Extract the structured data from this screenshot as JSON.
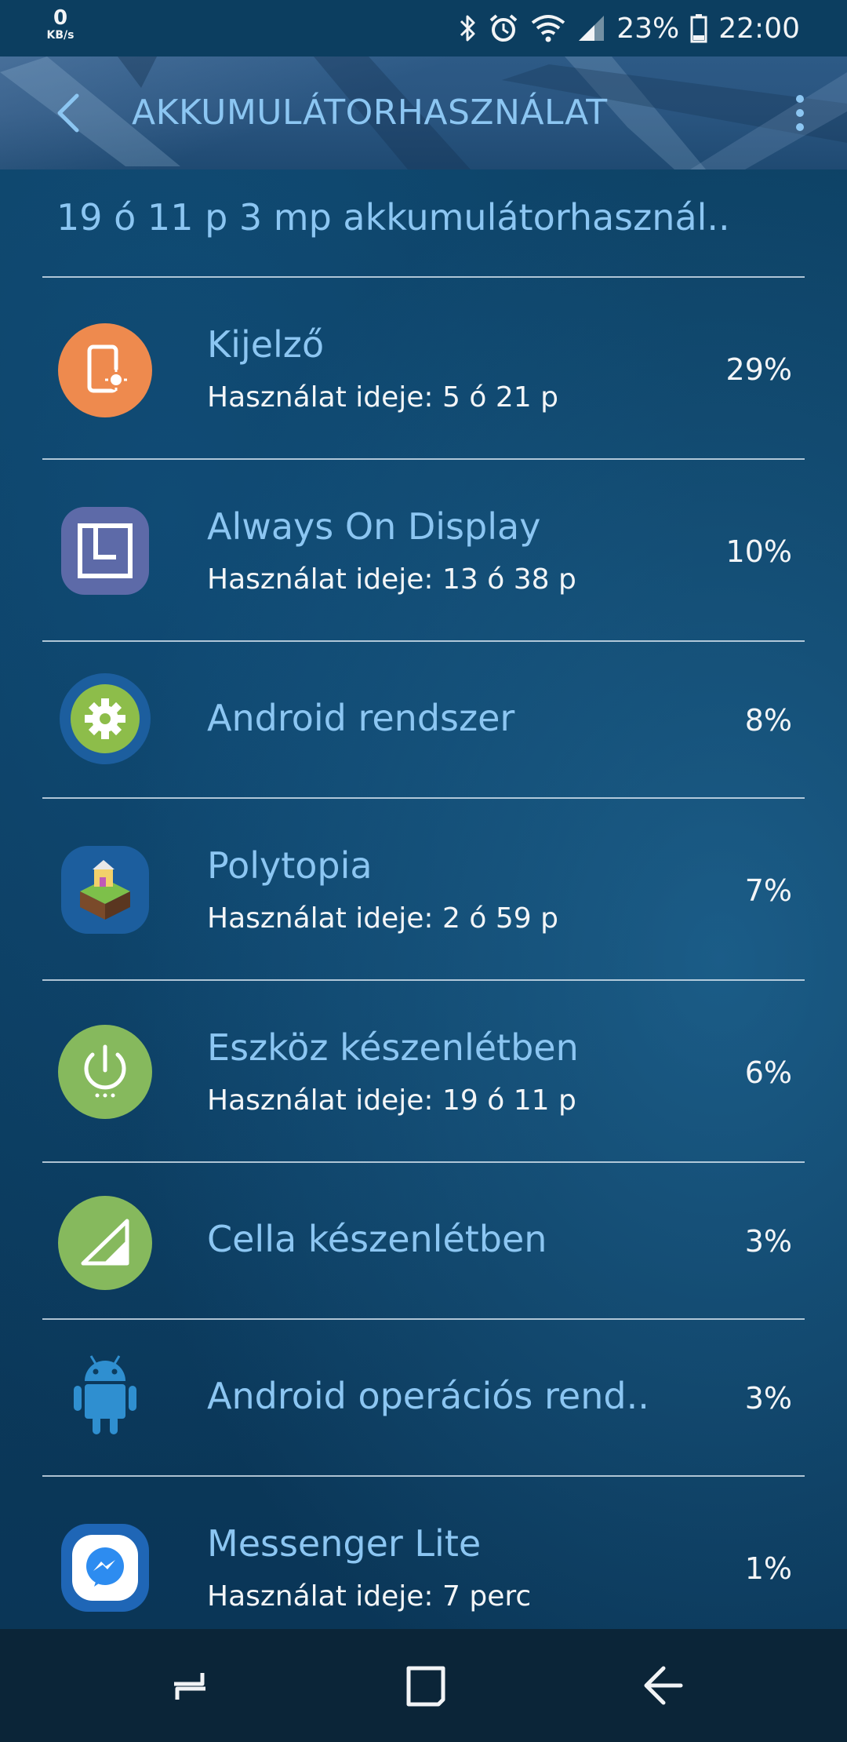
{
  "status_bar": {
    "net_speed_value": "0",
    "net_speed_unit": "KB/s",
    "battery_level": "23%",
    "time": "22:00",
    "icons": [
      "bluetooth-icon",
      "alarm-icon",
      "wifi-icon",
      "cell-signal-icon",
      "battery-icon"
    ]
  },
  "app_bar": {
    "title": "AKKUMULÁTORHASZNÁLAT",
    "back_icon": "back-arrow-icon",
    "more_icon": "more-vert-icon"
  },
  "summary": "19 ó 11 p 3 mp akkumulátorhasznál..",
  "items": [
    {
      "name": "Kijelző",
      "usage": "Használat ideje: 5 ó 21 p",
      "percent": "29%",
      "icon": "display-icon",
      "icon_color": "#ee8a4e"
    },
    {
      "name": "Always On Display",
      "usage": "Használat ideje: 13 ó 38 p",
      "percent": "10%",
      "icon": "always-on-display-icon",
      "icon_color": "#5d6aa8"
    },
    {
      "name": "Android rendszer",
      "usage": "",
      "percent": "8%",
      "icon": "android-system-gear-icon",
      "icon_color": "#8dbd4a"
    },
    {
      "name": "Polytopia",
      "usage": "Használat ideje: 2 ó 59 p",
      "percent": "7%",
      "icon": "polytopia-icon",
      "icon_color": "#1c5e9e"
    },
    {
      "name": "Eszköz készenlétben",
      "usage": "Használat ideje: 19 ó 11 p",
      "percent": "6%",
      "icon": "device-standby-power-icon",
      "icon_color": "#86b95d"
    },
    {
      "name": "Cella készenlétben",
      "usage": "",
      "percent": "3%",
      "icon": "cell-standby-signal-icon",
      "icon_color": "#86b95d"
    },
    {
      "name": "Android operációs rend..",
      "usage": "",
      "percent": "3%",
      "icon": "android-robot-icon",
      "icon_color": "#2f8fd0"
    },
    {
      "name": "Messenger Lite",
      "usage": "Használat ideje: 7 perc",
      "percent": "1%",
      "icon": "messenger-lite-icon",
      "icon_color": "#1f66b6"
    }
  ],
  "nav_bar": {
    "buttons": [
      "recents-icon",
      "home-icon",
      "back-icon"
    ]
  }
}
